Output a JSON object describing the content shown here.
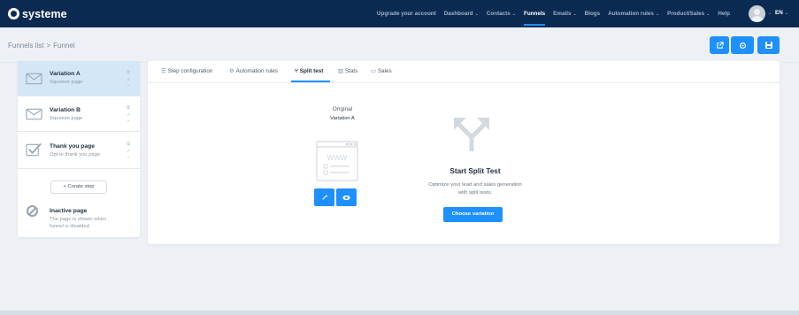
{
  "brand": {
    "name": "systeme"
  },
  "nav": {
    "items": [
      {
        "label": "Upgrade your account",
        "dropdown": false,
        "active": false
      },
      {
        "label": "Dashboard",
        "dropdown": true,
        "active": false
      },
      {
        "label": "Contacts",
        "dropdown": true,
        "active": false
      },
      {
        "label": "Funnels",
        "dropdown": false,
        "active": true
      },
      {
        "label": "Emails",
        "dropdown": true,
        "active": false
      },
      {
        "label": "Blogs",
        "dropdown": false,
        "active": false
      },
      {
        "label": "Automation rules",
        "dropdown": true,
        "active": false
      },
      {
        "label": "Product/Sales",
        "dropdown": true,
        "active": false
      },
      {
        "label": "Help",
        "dropdown": false,
        "active": false
      }
    ],
    "caret": "⌄",
    "language": "EN"
  },
  "breadcrumb": {
    "parent": "Funnels list",
    "separator": ">",
    "current": "Funnel"
  },
  "header_buttons": [
    {
      "icon": "external-link-icon"
    },
    {
      "icon": "gear-icon"
    },
    {
      "icon": "save-icon"
    }
  ],
  "sidebar": {
    "steps": [
      {
        "title": "Variation A",
        "subtitle": "Squeeze page",
        "icon": "envelope-icon",
        "active": true
      },
      {
        "title": "Variation B",
        "subtitle": "Squeeze page",
        "icon": "envelope-icon",
        "active": false
      },
      {
        "title": "Thank you page",
        "subtitle": "Opt-in thank you page",
        "icon": "checkbox-icon",
        "active": false
      }
    ],
    "create_label": "+ Create step",
    "inactive": {
      "title": "Inactive page",
      "description_line1": "The page is shown when",
      "description_line2": "funnel is disabled"
    }
  },
  "tabs": [
    {
      "label": "Step configuration",
      "icon": "list-icon",
      "active": false
    },
    {
      "label": "Automation rules",
      "icon": "cogs-icon",
      "active": false
    },
    {
      "label": "Split test",
      "icon": "split-icon",
      "active": true
    },
    {
      "label": "Stats",
      "icon": "bar-chart-icon",
      "active": false
    },
    {
      "label": "Sales",
      "icon": "money-icon",
      "active": false
    }
  ],
  "split_test": {
    "original_label": "Original",
    "original_name": "Variation A",
    "preview_text": "WWW",
    "title": "Start Split Test",
    "description_line1": "Optimize your lead and sales generation",
    "description_line2": "with split tests.",
    "choose_label": "Choose variation"
  },
  "colors": {
    "topbar": "#0b2a52",
    "accent": "#1e90ff",
    "active_step_bg": "#d4e7f7",
    "page_bg": "#edf1f5"
  }
}
